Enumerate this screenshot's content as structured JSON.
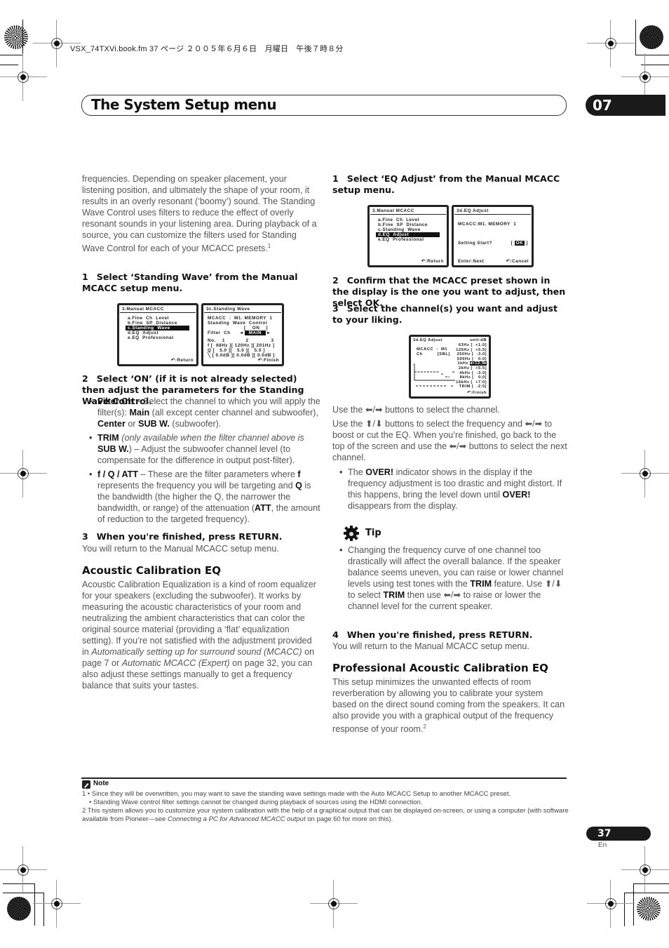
{
  "header": {
    "file_info": "VSX_74TXVi.book.fm  37 ページ  ２００５年６月６日　月曜日　午後７時８分",
    "section_title": "The System Setup menu",
    "chapter_number": "07"
  },
  "left_column": {
    "intro_paragraph": "frequencies. Depending on speaker placement, your listening position, and ultimately the shape of your room, it results in an overly resonant (‘boomy’) sound. The Standing Wave Control uses filters to reduce the effect of overly resonant sounds in your listening area. During playback of a source, you can customize the filters used for Standing Wave Control for each of your MCACC presets.",
    "intro_footnote_ref": "1",
    "step1": {
      "num": "1",
      "text": "Select ‘Standing Wave’ from the Manual MCACC setup menu."
    },
    "osd_manual_menu": {
      "title": "3.Manual  MCACC",
      "items": [
        "a.Fine  Ch  Level",
        "b.Fine  SP  Distance",
        "c.Standing  Wave",
        "d.EQ  Adjust",
        "e.EQ  Professional"
      ],
      "selected_index": 2,
      "footer": "↶:Return"
    },
    "osd_standing_wave": {
      "title": "3c.Standing  Wave",
      "line1": "MCACC  :  M1. MEMORY  1",
      "line2": "Standing  Wave  Control",
      "on_value": "[    ON    ]",
      "filter_label": "Filter  Ch",
      "filter_value": "MAIN",
      "table_header": [
        "No.",
        "1",
        "2",
        "3"
      ],
      "rows": [
        {
          "label": "f",
          "values": [
            "68Hz",
            "120Hz",
            "201Hz"
          ]
        },
        {
          "label": "Q",
          "values": [
            "5.0",
            "5.0",
            "5.0"
          ]
        },
        {
          "label": "ATT",
          "values": [
            "0.0dB",
            "0.0dB",
            "0.0dB"
          ]
        }
      ],
      "footer": "↶:Finish"
    },
    "step2": {
      "num": "2",
      "text": "Select ‘ON’ (if it is not already selected) then adjust the parameters for the Standing Wave Control."
    },
    "bullets": [
      {
        "term": "Filter Ch",
        "text1": " – Select the channel to which you will apply the filter(s): ",
        "b1": "Main",
        "text2": " (all except center channel and subwoofer), ",
        "b2": "Center",
        "text3": " or ",
        "b3": "SUB W.",
        "text4": " (subwoofer)."
      },
      {
        "term": "TRIM",
        "italic": " (only available when the filter channel above is ",
        "b1": "SUB W.",
        "text1": ") – Adjust the subwoofer channel level (to compensate for the difference in output post-filter)."
      },
      {
        "term": "f / Q / ATT",
        "text1": " – These are the filter parameters where ",
        "b1": "f",
        "text2": " represents the frequency you will be targeting and ",
        "b2": "Q",
        "text3": " is the bandwidth (the higher the Q, the narrower the bandwidth, or range) of the attenuation (",
        "b3": "ATT",
        "text4": ", the amount of reduction to the targeted frequency)."
      }
    ],
    "step3": {
      "num": "3",
      "text": "When you're finished, press RETURN."
    },
    "step3_note": "You will return to the Manual MCACC setup menu.",
    "acoustic_heading": "Acoustic Calibration EQ",
    "acoustic_p1": "Acoustic Calibration Equalization is a kind of room equalizer for your speakers (excluding the subwoofer). It works by measuring the acoustic characteristics of your room and neutralizing the ambient characteristics that can color the original source material (providing a ‘flat’ equalization setting). If you’re not satisfied with the adjustment provided in ",
    "acoustic_link1": "Automatically setting up for surround sound (MCACC)",
    "acoustic_p2": " on page 7 or ",
    "acoustic_link2": "Automatic MCACC (Expert)",
    "acoustic_p3": " on page 32, you can also adjust these settings manually to get a frequency balance that suits your tastes."
  },
  "right_column": {
    "step1": {
      "num": "1",
      "text": "Select ‘EQ Adjust’ from the Manual MCACC setup menu."
    },
    "osd_manual_menu": {
      "title": "3.Manual  MCACC",
      "items": [
        "a.Fine  Ch  Level",
        "b.Fine  SP  Distance",
        "c.Standing  Wave",
        "d.EQ  Adjust",
        "e.EQ  Professional"
      ],
      "selected_index": 3,
      "footer": "↶:Return"
    },
    "osd_eq_start": {
      "title": "3d.EQ  Adjust",
      "line1": "MCACC:M1. MEMORY  1",
      "prompt": "Setting  Start?",
      "ok": "OK",
      "footer_left": "Enter:Next",
      "footer_right": "↶:Cancel"
    },
    "step2": {
      "num": "2",
      "text": "Confirm that the MCACC preset shown in the display is the one you want to adjust, then select OK."
    },
    "step3": {
      "num": "3",
      "text": "Select the channel(s) you want and adjust to your liking."
    },
    "osd_eq_adjust": {
      "title": "3d.EQ  Adjust",
      "unit": "unit:dB",
      "mcacc": "MCACC  :  M1",
      "ch": "Ch          [SBL]",
      "bands": [
        {
          "freq": "63Hz",
          "value": "+1.0"
        },
        {
          "freq": "125Hz",
          "value": "+5.5"
        },
        {
          "freq": "250Hz",
          "value": "-3.0"
        },
        {
          "freq": "500Hz",
          "value": "0.0"
        },
        {
          "freq": "1kHz",
          "value": "+12.0"
        },
        {
          "freq": "2kHz",
          "value": "+5.5"
        },
        {
          "freq": "4kHz",
          "value": "-3.0"
        },
        {
          "freq": "8kHz",
          "value": "0.0"
        },
        {
          "freq": "16kHz",
          "value": "+7.0"
        },
        {
          "freq": "TRIM",
          "value": "-2.5"
        }
      ],
      "selected_band": 4,
      "footer": "↶:Finish"
    },
    "para_channel": "Use the ⬅/➡ buttons to select the channel.",
    "para_freq": "Use the ⬆/⬇ buttons to select the frequency and ⬅/➡ to boost or cut the EQ. When you’re finished, go back to the top of the screen and use the ⬅/➡ buttons to select the next channel.",
    "over_bullet": {
      "pre": "The ",
      "b1": "OVER!",
      "mid": " indicator shows in the display if the frequency adjustment is too drastic and might distort. If this happens, bring the level down until ",
      "b2": "OVER!",
      "post": " disappears from the display."
    },
    "tip_label": "Tip",
    "tip_bullet": {
      "t1": "Changing the frequency curve of one channel too drastically will affect the overall balance. If the speaker balance seems uneven, you can raise or lower channel levels using test tones with the ",
      "b1": "TRIM",
      "t2": " feature. Use ⬆/⬇ to select ",
      "b2": "TRIM",
      "t3": " then use ⬅/➡ to raise or lower the channel level for the current speaker."
    },
    "step4": {
      "num": "4",
      "text": "When you're finished, press RETURN."
    },
    "step4_note": "You will return to the Manual MCACC setup menu.",
    "pro_heading": "Professional Acoustic Calibration EQ",
    "pro_paragraph": "This setup minimizes the unwanted effects of room reverberation by allowing you to calibrate your system based on the direct sound coming from the speakers. It can also provide you with a graphical output of the frequency response of your room.",
    "pro_footnote_ref": "2"
  },
  "notes": {
    "label": "Note",
    "n1_a": "1  • Since they will be overwritten, you may want to save the standing wave settings made with the Auto MCACC Setup to another MCACC preset.",
    "n1_b": "• Standing Wave control filter settings cannot be changed during playback of sources using the HDMI connection.",
    "n2_pre": "2 This system allows you to customize your system calibration with the help of a graphical output that can be displayed on-screen, or using a computer (with software available from Pioneer—see ",
    "n2_link": "Connecting a PC for Advanced MCACC output",
    "n2_post": " on page 60 for more on this)."
  },
  "page": {
    "number": "37",
    "lang": "En"
  }
}
